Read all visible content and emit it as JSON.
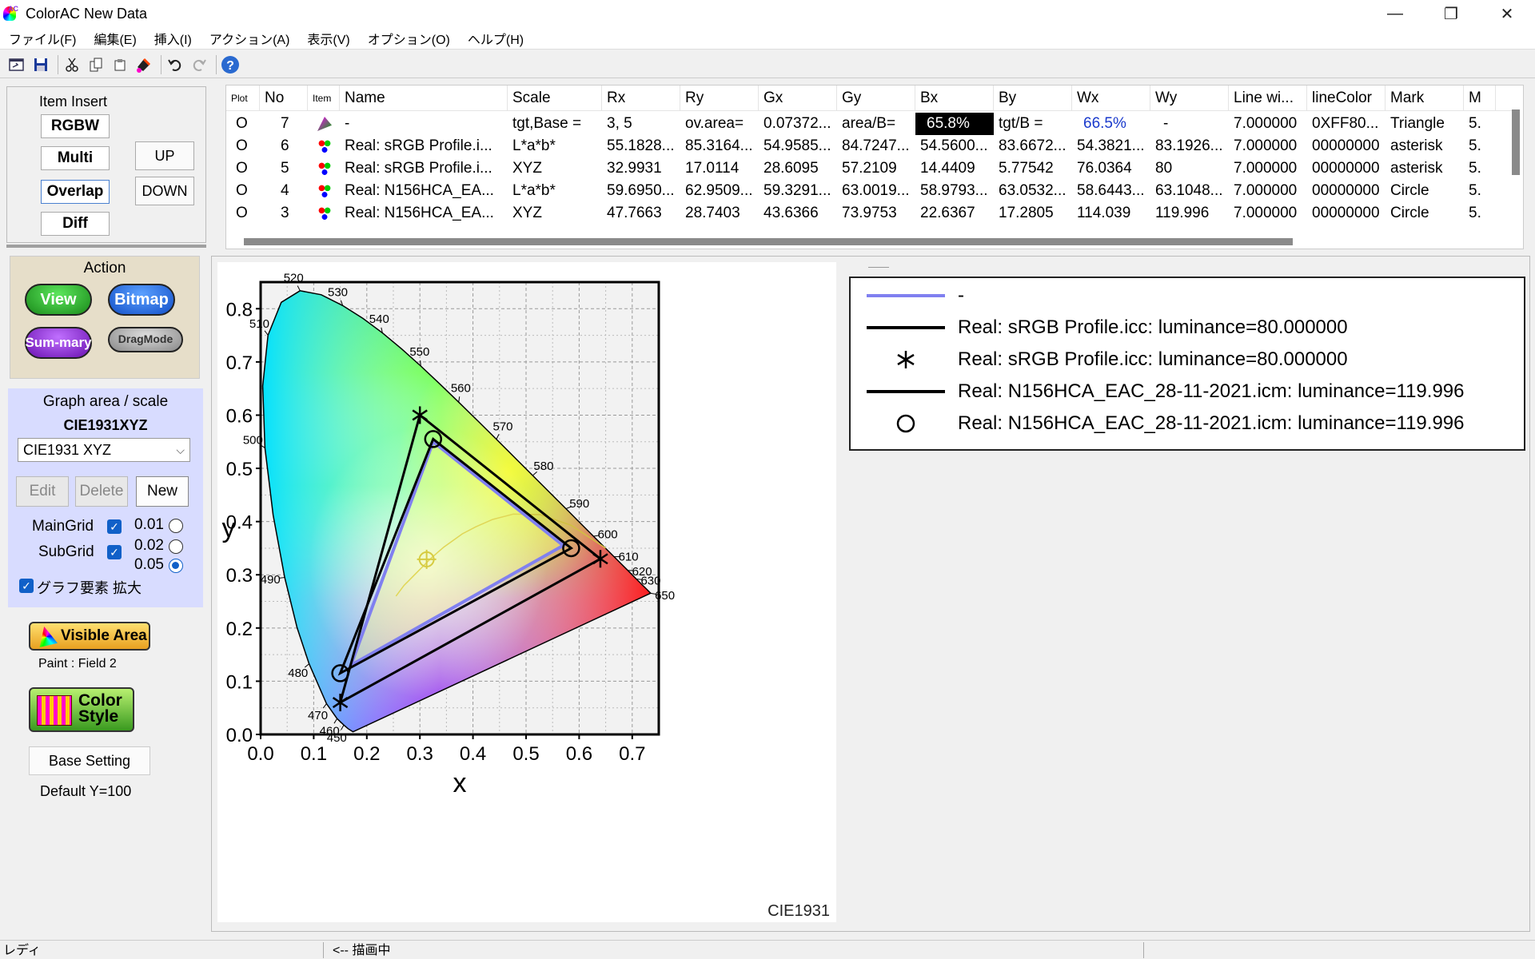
{
  "window": {
    "title": "ColorAC  New Data",
    "min": "—",
    "max": "❐",
    "close": "✕"
  },
  "menu": [
    "ファイル(F)",
    "編集(E)",
    "挿入(I)",
    "アクション(A)",
    "表示(V)",
    "オプション(O)",
    "ヘルプ(H)"
  ],
  "toolbar_icons": [
    "export-icon",
    "save-icon",
    "cut-icon",
    "copy-icon",
    "paste-icon",
    "paint-icon",
    "undo-icon",
    "redo-icon",
    "help-icon"
  ],
  "item_insert": {
    "title": "Item Insert",
    "rgbw": "RGBW",
    "multi": "Multi",
    "overlap": "Overlap",
    "diff": "Diff",
    "up": "UP",
    "down": "DOWN"
  },
  "action": {
    "title": "Action",
    "view": "View",
    "bitmap": "Bitmap",
    "summary_1": "Sum-",
    "summary_2": "mary",
    "drag_1": "Drag",
    "drag_2": "Mode"
  },
  "graph_area": {
    "title": "Graph area / scale",
    "current": "CIE1931XYZ",
    "select_value": "CIE1931 XYZ",
    "edit": "Edit",
    "delete": "Delete",
    "new": "New",
    "main_grid": "MainGrid",
    "sub_grid": "SubGrid",
    "r001": "0.01",
    "r002": "0.02",
    "r005": "0.05",
    "enlarge": "グラフ要素 拡大"
  },
  "visible_area": "Visible Area",
  "paint_field": "Paint  : Field 2",
  "color_style_1": "Color",
  "color_style_2": "Style",
  "base_setting": "Base Setting",
  "default_y": "Default Y=100",
  "table": {
    "headers": [
      "Plot",
      "No",
      "Item",
      "Name",
      "Scale",
      "Rx",
      "Ry",
      "Gx",
      "Gy",
      "Bx",
      "By",
      "Wx",
      "Wy",
      "Line wi...",
      "lineColor",
      "Mark",
      "M"
    ],
    "rows": [
      [
        "O",
        "7",
        "",
        "-",
        "tgt,Base =",
        "3, 5",
        "ov.area=",
        "0.07372...",
        "area/B=",
        "65.8%",
        "tgt/B =",
        "66.5%",
        "-",
        "7.000000",
        "0XFF80...",
        "Triangle",
        "5."
      ],
      [
        "O",
        "6",
        "",
        "Real: sRGB Profile.i...",
        "L*a*b*",
        "55.1828...",
        "85.3164...",
        "54.9585...",
        "84.7247...",
        "54.5600...",
        "83.6672...",
        "54.3821...",
        "83.1926...",
        "7.000000",
        "00000000",
        "asterisk",
        "5."
      ],
      [
        "O",
        "5",
        "",
        "Real: sRGB Profile.i...",
        "XYZ",
        "32.9931",
        "17.0114",
        "28.6095",
        "57.2109",
        "14.4409",
        "5.77542",
        "76.0364",
        "80",
        "7.000000",
        "00000000",
        "asterisk",
        "5."
      ],
      [
        "O",
        "4",
        "",
        "Real: N156HCA_EA...",
        "L*a*b*",
        "59.6950...",
        "62.9509...",
        "59.3291...",
        "63.0019...",
        "58.9793...",
        "63.0532...",
        "58.6443...",
        "63.1048...",
        "7.000000",
        "00000000",
        "Circle",
        "5."
      ],
      [
        "O",
        "3",
        "",
        "Real: N156HCA_EA...",
        "XYZ",
        "47.7663",
        "28.7403",
        "43.6366",
        "73.9753",
        "22.6367",
        "17.2805",
        "114.039",
        "119.996",
        "7.000000",
        "00000000",
        "Circle",
        "5."
      ]
    ]
  },
  "legend": [
    {
      "symbol": "blue-line",
      "text": "-"
    },
    {
      "symbol": "black-line",
      "text": "Real: sRGB Profile.icc: luminance=80.000000"
    },
    {
      "symbol": "asterisk",
      "text": "Real: sRGB Profile.icc: luminance=80.000000"
    },
    {
      "symbol": "black-line",
      "text": "Real: N156HCA_EAC_28-11-2021.icm: luminance=119.996"
    },
    {
      "symbol": "circle",
      "text": "Real: N156HCA_EAC_28-11-2021.icm: luminance=119.996"
    }
  ],
  "chart_data": {
    "type": "scatter",
    "xlabel": "x",
    "ylabel": "y",
    "footer": "CIE1931",
    "xlim": [
      0.0,
      0.75
    ],
    "ylim": [
      0.0,
      0.85
    ],
    "xticks": [
      "0.0",
      "0.1",
      "0.2",
      "0.3",
      "0.4",
      "0.5",
      "0.6",
      "0.7"
    ],
    "yticks": [
      "0.0",
      "0.1",
      "0.2",
      "0.3",
      "0.4",
      "0.5",
      "0.6",
      "0.7",
      "0.8"
    ],
    "grid": true,
    "spectral_locus": [
      [
        0.1741,
        0.005
      ],
      [
        0.1644,
        0.0109
      ],
      [
        0.1566,
        0.0177
      ],
      [
        0.144,
        0.0297
      ],
      [
        0.1241,
        0.0578
      ],
      [
        0.0913,
        0.1327
      ],
      [
        0.0687,
        0.2007
      ],
      [
        0.0454,
        0.295
      ],
      [
        0.0235,
        0.4127
      ],
      [
        0.0082,
        0.5384
      ],
      [
        0.0039,
        0.6548
      ],
      [
        0.0139,
        0.7502
      ],
      [
        0.0389,
        0.812
      ],
      [
        0.0743,
        0.8338
      ],
      [
        0.1142,
        0.8262
      ],
      [
        0.1547,
        0.8059
      ],
      [
        0.1929,
        0.7816
      ],
      [
        0.2296,
        0.7543
      ],
      [
        0.2658,
        0.7243
      ],
      [
        0.3016,
        0.6923
      ],
      [
        0.3373,
        0.6589
      ],
      [
        0.3731,
        0.6245
      ],
      [
        0.4087,
        0.5896
      ],
      [
        0.4441,
        0.5547
      ],
      [
        0.4788,
        0.5202
      ],
      [
        0.5125,
        0.4866
      ],
      [
        0.5448,
        0.4544
      ],
      [
        0.5752,
        0.4242
      ],
      [
        0.6029,
        0.3965
      ],
      [
        0.627,
        0.3725
      ],
      [
        0.6482,
        0.3514
      ],
      [
        0.6658,
        0.334
      ],
      [
        0.6801,
        0.3197
      ],
      [
        0.6915,
        0.3083
      ],
      [
        0.7006,
        0.2993
      ],
      [
        0.7079,
        0.292
      ],
      [
        0.714,
        0.2859
      ],
      [
        0.719,
        0.2809
      ],
      [
        0.723,
        0.277
      ],
      [
        0.726,
        0.274
      ],
      [
        0.7347,
        0.2653
      ]
    ],
    "wavelength_labels": [
      {
        "nm": "450",
        "x": 0.1566,
        "y": 0.0177
      },
      {
        "nm": "460",
        "x": 0.144,
        "y": 0.0297
      },
      {
        "nm": "470",
        "x": 0.1241,
        "y": 0.0578
      },
      {
        "nm": "480",
        "x": 0.0913,
        "y": 0.1327
      },
      {
        "nm": "490",
        "x": 0.0454,
        "y": 0.295
      },
      {
        "nm": "500",
        "x": 0.0082,
        "y": 0.5384
      },
      {
        "nm": "510",
        "x": 0.0139,
        "y": 0.7502
      },
      {
        "nm": "520",
        "x": 0.0743,
        "y": 0.8338
      },
      {
        "nm": "530",
        "x": 0.1547,
        "y": 0.8059
      },
      {
        "nm": "540",
        "x": 0.2296,
        "y": 0.7543
      },
      {
        "nm": "550",
        "x": 0.3016,
        "y": 0.6923
      },
      {
        "nm": "560",
        "x": 0.3731,
        "y": 0.6245
      },
      {
        "nm": "570",
        "x": 0.4441,
        "y": 0.5547
      },
      {
        "nm": "580",
        "x": 0.5125,
        "y": 0.4866
      },
      {
        "nm": "590",
        "x": 0.5752,
        "y": 0.4242
      },
      {
        "nm": "600",
        "x": 0.627,
        "y": 0.3725
      },
      {
        "nm": "610",
        "x": 0.6658,
        "y": 0.334
      },
      {
        "nm": "620",
        "x": 0.6915,
        "y": 0.3083
      },
      {
        "nm": "630",
        "x": 0.7079,
        "y": 0.292
      },
      {
        "nm": "650",
        "x": 0.7347,
        "y": 0.2653
      }
    ],
    "series": [
      {
        "name": "-",
        "color": "#8080f0",
        "points": [
          [
            0.325,
            0.55
          ],
          [
            0.57,
            0.355
          ],
          [
            0.17,
            0.13
          ]
        ]
      },
      {
        "name": "Real: sRGB Profile.icc: luminance=80.000000",
        "color": "#000000",
        "marker": "asterisk",
        "points": [
          [
            0.3,
            0.6
          ],
          [
            0.64,
            0.33
          ],
          [
            0.15,
            0.06
          ]
        ]
      },
      {
        "name": "Real: N156HCA_EAC_28-11-2021.icm: luminance=119.996",
        "color": "#000000",
        "marker": "circle",
        "points": [
          [
            0.325,
            0.555
          ],
          [
            0.585,
            0.35
          ],
          [
            0.15,
            0.115
          ]
        ]
      }
    ],
    "planckian_locus": [
      [
        0.65,
        0.35
      ],
      [
        0.585,
        0.393
      ],
      [
        0.527,
        0.413
      ],
      [
        0.476,
        0.414
      ],
      [
        0.437,
        0.404
      ],
      [
        0.405,
        0.39
      ],
      [
        0.38,
        0.377
      ],
      [
        0.345,
        0.352
      ],
      [
        0.322,
        0.332
      ],
      [
        0.29,
        0.3
      ],
      [
        0.27,
        0.28
      ],
      [
        0.255,
        0.26
      ]
    ],
    "white_point": [
      0.3127,
      0.329
    ]
  },
  "status": {
    "left": "レディ",
    "middle": "<-- 描画中"
  }
}
